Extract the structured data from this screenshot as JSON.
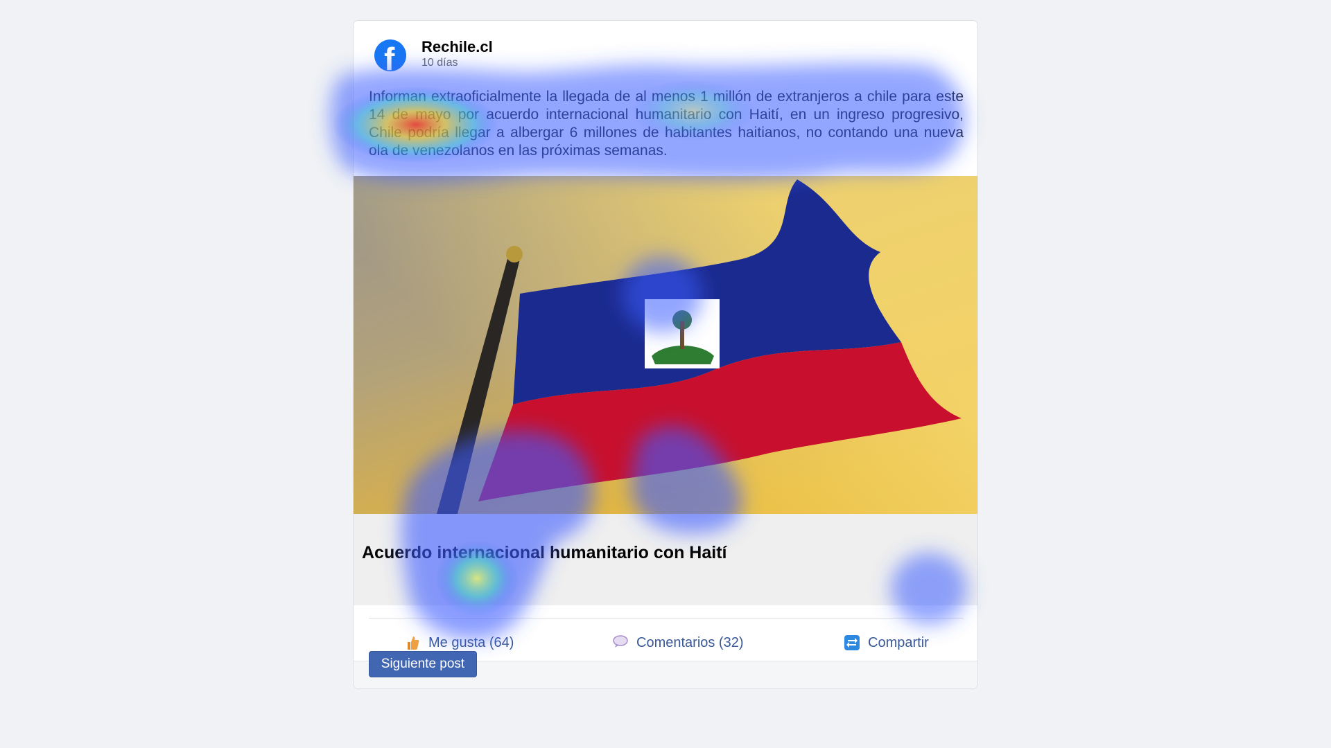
{
  "post": {
    "author": "Rechile.cl",
    "time": "10 días",
    "text": "Informan extraoficialmente la llegada de al menos 1 millón de extranjeros a chile para este 14 de mayo por acuerdo internacional humanitario con Haití, en un ingreso progresivo, Chile podría llegar a albergar 6 millones de habitantes haitianos, no contando una nueva ola de venezolanos en las próximas semanas.",
    "link_title": "Acuerdo internacional humanitario con Haití"
  },
  "actions": {
    "like_label": "Me gusta (64)",
    "comments_label": "Comentarios (32)",
    "share_label": "Compartir"
  },
  "navigation": {
    "next_label": "Siguiente post"
  },
  "icons": {
    "logo": "facebook-logo-icon",
    "like": "thumbs-up-icon",
    "comment": "speech-bubble-icon",
    "share": "share-arrows-icon"
  },
  "colors": {
    "brand": "#1877f2",
    "link": "#385898",
    "button": "#4267b2",
    "flag_blue": "#1b2a8f",
    "flag_red": "#c8102e"
  }
}
